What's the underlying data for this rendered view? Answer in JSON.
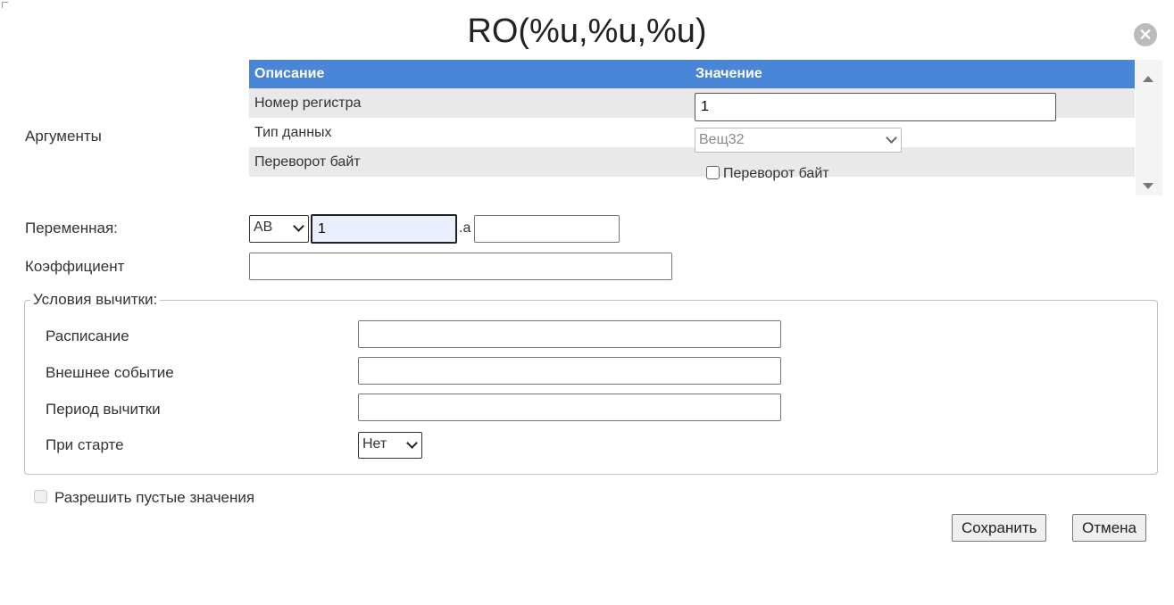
{
  "dialog": {
    "title": "RO(%u,%u,%u)"
  },
  "arguments": {
    "label": "Аргументы",
    "table": {
      "headers": [
        "Описание",
        "Значение"
      ],
      "rows": [
        {
          "description": "Номер регистра",
          "value": "1"
        },
        {
          "description": "Тип данных",
          "value": "Вещ32"
        },
        {
          "description": "Переворот байт",
          "checkbox_label": "Переворот байт",
          "checked": false
        }
      ]
    }
  },
  "variable": {
    "label": "Переменная:",
    "prefix_selected": "AB",
    "number_value": "1",
    "separator": ".a",
    "suffix_value": ""
  },
  "coefficient": {
    "label": "Коэффициент",
    "value": ""
  },
  "conditions": {
    "legend": "Условия вычитки:",
    "schedule_label": "Расписание",
    "schedule_value": "",
    "event_label": "Внешнее событие",
    "event_value": "",
    "period_label": "Период вычитки",
    "period_value": "",
    "on_start_label": "При старте",
    "on_start_selected": "Нет"
  },
  "allow_empty": {
    "label": "Разрешить пустые значения",
    "checked": false
  },
  "buttons": {
    "save_label": "Сохранить",
    "cancel_label": "Отмена"
  },
  "colors": {
    "header_bg": "#4a86d8",
    "row_alt_bg": "#e9e9e9"
  },
  "icons": {
    "close": "close-circle-icon",
    "dropdown": "chevron-down-icon"
  }
}
